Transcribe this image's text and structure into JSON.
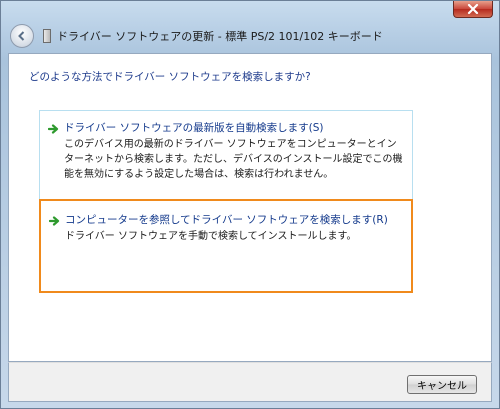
{
  "window": {
    "title": "ドライバー ソフトウェアの更新 - 標準 PS/2 101/102 キーボード",
    "close_icon": "close-icon",
    "back_icon": "back-arrow-icon",
    "device_icon": "device-icon"
  },
  "content": {
    "question": "どのような方法でドライバー ソフトウェアを検索しますか?",
    "options": [
      {
        "title": "ドライバー ソフトウェアの最新版を自動検索します(S)",
        "description": "このデバイス用の最新のドライバー ソフトウェアをコンピューターとインターネットから検索します。ただし、デバイスのインストール設定でこの機能を無効にするよう設定した場合は、検索は行われません。",
        "icon": "green-arrow-icon"
      },
      {
        "title": "コンピューターを参照してドライバー ソフトウェアを検索します(R)",
        "description": "ドライバー ソフトウェアを手動で検索してインストールします。",
        "icon": "green-arrow-icon",
        "highlighted": true
      }
    ]
  },
  "footer": {
    "cancel_label": "キャンセル"
  },
  "colors": {
    "link_blue": "#143a8c",
    "highlight_orange": "#f08a1c",
    "arrow_green": "#2e9a2e"
  }
}
